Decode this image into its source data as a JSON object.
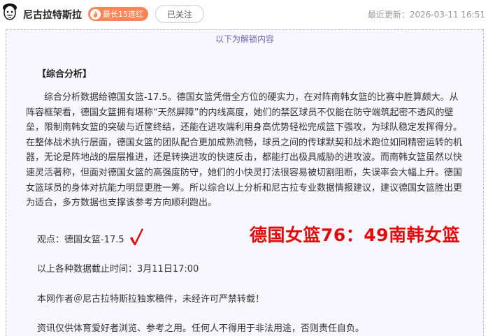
{
  "header": {
    "author_name": "尼古拉特斯拉",
    "streak_badge": "最长15连红",
    "follow_label": "已关注",
    "update_time": "最近更新：2026-03-11 16:51"
  },
  "unlock": {
    "label": "以下为解锁内容"
  },
  "article": {
    "section_heading": "【综合分析】",
    "analysis": "综合分析数据给德国女篮-17.5。德国女篮凭借全方位的硬实力，在对阵南韩女篮的比赛中胜算颇大。从阵容框架看，德国女篮拥有堪称“天然屏障”的内线高度，她们的禁区球员不仅能在防守端筑起密不透风的壁垒，限制南韩女篮的突破与近筐终结，还能在进攻端利用身高优势轻松完成篮下强攻，为球队稳定发挥得分。在整体战术执行层面，德国女篮的团队配合更加成熟流畅，球员之间的传球默契和战术跑位如同精密运转的机器，无论是阵地战的层层推进，还是转换进攻的快速反击，都能打出极具威胁的进攻波。而南韩女篮虽然以快速灵活著称，但面对德国女篮的高强度防守，她们的小快灵打法很容易被切割阻断，失误率会大幅上升。德国女篮球员的身体对抗能力明显更胜一筹。所以综合以上分析和尼古拉专业数据情报建议，建议德国女篮胜出更为适合，多方数据也支撑该参考方向顺利跑出。",
    "viewpoint": "观点：德国女篮-17.5",
    "result": "德国女篮76：49南韩女篮",
    "cutoff": "以上各种数据截止时间：3月11日17:00",
    "copyright": "本网作者＠尼古拉特斯拉独家稿件，未经许可严禁转载！",
    "disclaimer": "资讯仅供体育爱好者浏览、参考之用。任何人不得用于非法用途，否则责任自负。"
  },
  "icons": {
    "avatar": "cartoon-face-avatar",
    "flame": "flame-icon",
    "check": "check-mark-icon"
  },
  "colors": {
    "streak_badge": "#ff8557",
    "result_text": "#e00b0b",
    "unlock_border": "#b9b0e0",
    "unlock_label": "#6f63b8"
  }
}
